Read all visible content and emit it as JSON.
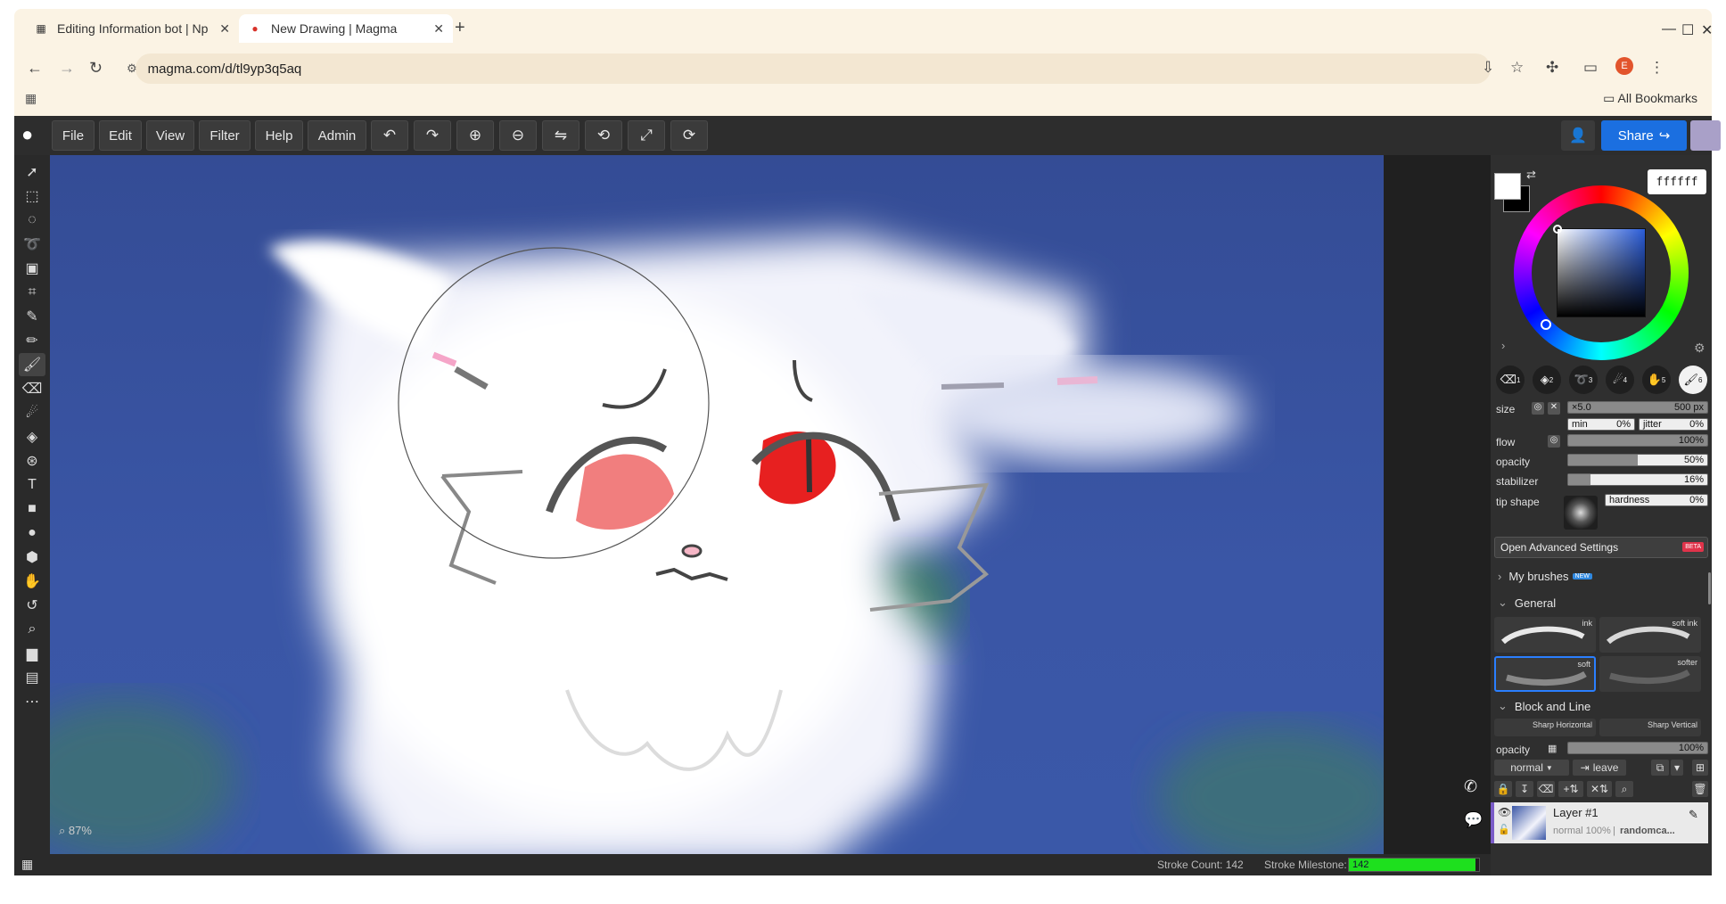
{
  "browser": {
    "tabs": [
      {
        "title": "Editing Information bot | Np"
      },
      {
        "title": "New Drawing | Magma"
      }
    ],
    "url": "magma.com/d/tl9yp3q5aq",
    "bookmarks_label": "All Bookmarks",
    "profile_initial": "E"
  },
  "menu": {
    "file": "File",
    "edit": "Edit",
    "view": "View",
    "filter": "Filter",
    "help": "Help",
    "admin": "Admin",
    "share": "Share"
  },
  "canvas": {
    "zoom": "87%"
  },
  "status": {
    "stroke_count": "Stroke Count: 142",
    "milestone_label": "Stroke Milestone:",
    "milestone_value": "142",
    "milestone_progress": 0.97
  },
  "color": {
    "hex": "ffffff",
    "primary": "#ffffff",
    "secondary": "#000000"
  },
  "brush_settings": {
    "presets": [
      "1",
      "2",
      "3",
      "4",
      "5",
      "6"
    ],
    "size_label": "size",
    "size_mult": "×5.0",
    "size_value": "500 px",
    "min_label": "min",
    "min_value": "0%",
    "jitter_label": "jitter",
    "jitter_value": "0%",
    "flow_label": "flow",
    "flow_value": "100%",
    "flow_fill": 1.0,
    "opacity_label": "opacity",
    "opacity_value": "50%",
    "opacity_fill": 0.5,
    "stabilizer_label": "stabilizer",
    "stabilizer_value": "16%",
    "stabilizer_fill": 0.16,
    "tip_shape_label": "tip shape",
    "hardness_label": "hardness",
    "hardness_value": "0%",
    "advanced": "Open Advanced Settings",
    "beta": "BETA"
  },
  "brushes": {
    "my_brushes": "My brushes",
    "new_badge": "NEW",
    "general": "General",
    "general_items": [
      "ink",
      "soft ink",
      "soft",
      "softer"
    ],
    "block_line": "Block and Line",
    "block_items": [
      "Sharp Horizontal",
      "Sharp Vertical"
    ]
  },
  "layers": {
    "opacity_label": "opacity",
    "opacity_value": "100%",
    "blend_mode": "normal",
    "leave": "leave",
    "layer_name": "Layer #1",
    "layer_info_mode": "normal 100%",
    "layer_info_owner": "randomca..."
  }
}
